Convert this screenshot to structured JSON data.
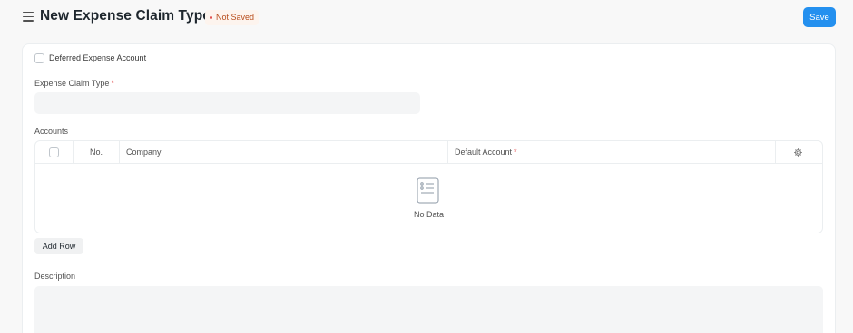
{
  "header": {
    "title": "New Expense Claim Type",
    "status": "Not Saved",
    "save_label": "Save",
    "menu_icon": "hamburger-menu-icon"
  },
  "form": {
    "deferred_checkbox": {
      "label": "Deferred Expense Account",
      "checked": false
    },
    "expense_claim_type": {
      "label": "Expense Claim Type",
      "required_mark": "*",
      "value": ""
    },
    "accounts": {
      "label": "Accounts",
      "columns": {
        "no": "No.",
        "company": "Company",
        "default_account": "Default Account",
        "default_account_required": "*"
      },
      "rows": [],
      "empty_text": "No Data",
      "add_row_label": "Add Row"
    },
    "description": {
      "label": "Description",
      "value": ""
    }
  },
  "colors": {
    "primary": "#2490ef",
    "required": "#e24c4c",
    "status_text": "#b84c1b",
    "status_bg": "#fdf4ee"
  }
}
